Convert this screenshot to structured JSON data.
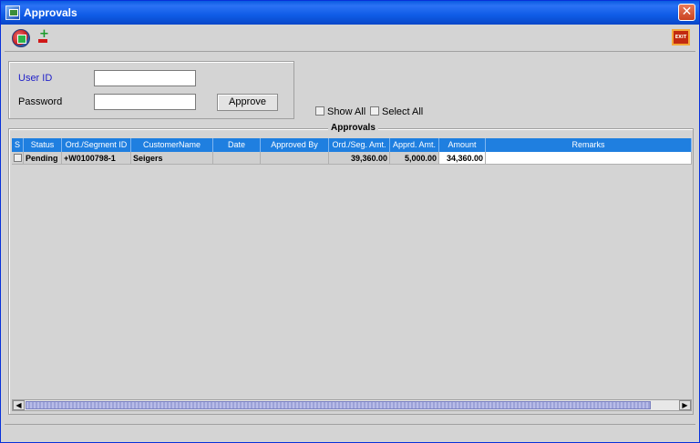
{
  "window": {
    "title": "Approvals",
    "close_label": "✕"
  },
  "toolbar": {
    "refresh_icon": "refresh-icon",
    "plusminus_icon": "plus-minus-icon",
    "exit_label": "EXIT"
  },
  "login": {
    "user_label": "User ID",
    "user_value": "",
    "password_label": "Password",
    "password_value": "",
    "approve_label": "Approve"
  },
  "options": {
    "show_all": "Show All",
    "select_all": "Select All"
  },
  "approvals": {
    "title": "Approvals",
    "columns": [
      "S",
      "Status",
      "Ord./Segment ID",
      "CustomerName",
      "Date",
      "Approved By",
      "Ord./Seg. Amt.",
      "Apprd. Amt.",
      "Amount",
      "Remarks"
    ],
    "rows": [
      {
        "status": "Pending",
        "segment_id": "+W0100798-1",
        "customer": "Seigers",
        "date": "",
        "approved_by": "",
        "ord_amt": "39,360.00",
        "apprd_amt": "5,000.00",
        "amount": "34,360.00",
        "remarks": ""
      }
    ]
  },
  "colors": {
    "header_blue": "#1f7fe0",
    "title_blue": "#0a5be0",
    "user_label": "#2020c8"
  }
}
